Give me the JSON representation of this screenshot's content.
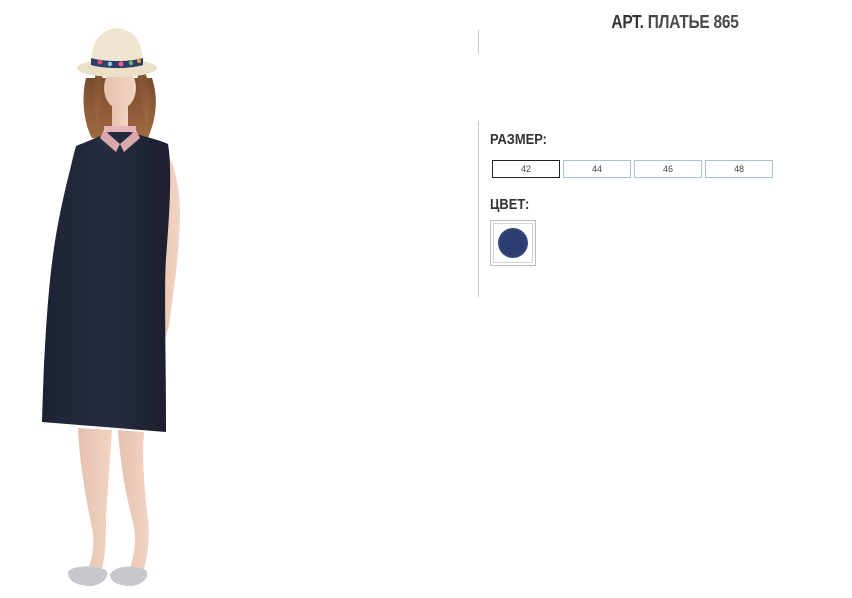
{
  "product": {
    "title_prefix": "АРТ.",
    "title_name": "ПЛАТЬЕ 865",
    "photo_alt": "Модель в темно-синем платье",
    "size_label": "РАЗМЕР:",
    "sizes": [
      {
        "label": "42",
        "selected": true
      },
      {
        "label": "44",
        "selected": false
      },
      {
        "label": "46",
        "selected": false
      },
      {
        "label": "48",
        "selected": false
      }
    ],
    "color_label": "ЦВЕТ:",
    "colors": [
      {
        "name": "navy",
        "hex": "#2c3c6e",
        "selected": true
      }
    ]
  }
}
